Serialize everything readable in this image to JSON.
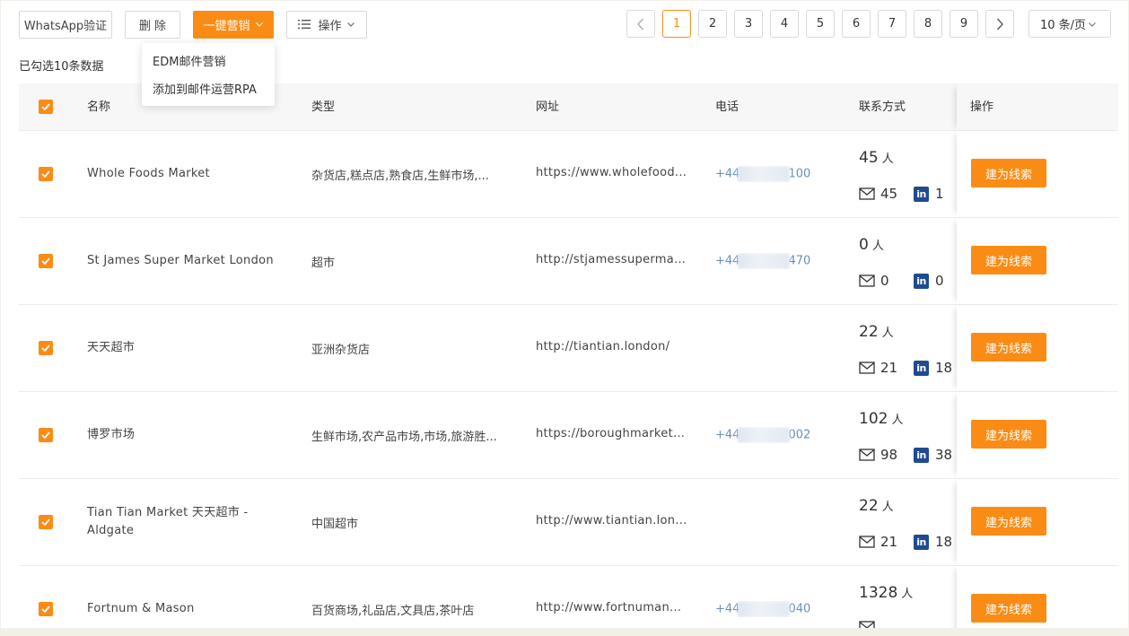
{
  "toolbar": {
    "whatsapp_label": "WhatsApp验证",
    "delete_label": "删 除",
    "marketing_label": "一键营销",
    "ops_label": "操作"
  },
  "dropdown": {
    "items": [
      "EDM邮件营销",
      "添加到邮件运营RPA"
    ]
  },
  "selected_info": "已勾选10条数据",
  "pagination": {
    "pages": [
      "1",
      "2",
      "3",
      "4",
      "5",
      "6",
      "7",
      "8",
      "9"
    ],
    "current": "1",
    "page_size": "10 条/页"
  },
  "table": {
    "headers": {
      "name": "名称",
      "type": "类型",
      "url": "网址",
      "phone": "电话",
      "contact": "联系方式",
      "action": "操作"
    },
    "unit_people": "人",
    "action_button": "建为线索",
    "rows": [
      {
        "name": "Whole Foods Market",
        "type": "杂货店,糕点店,熟食店,生鲜市场,...",
        "url": "https://www.wholefood...",
        "phone_prefix": "+44",
        "phone_suffix": "100",
        "people": "45",
        "email": "45",
        "linkedin": "1"
      },
      {
        "name": "St James Super Market London",
        "type": "超市",
        "url": "http://stjamessupermar...",
        "phone_prefix": "+44",
        "phone_suffix": "470",
        "people": "0",
        "email": "0",
        "linkedin": "0"
      },
      {
        "name": "天天超市",
        "type": "亚洲杂货店",
        "url": "http://tiantian.london/",
        "phone_prefix": "",
        "phone_suffix": "",
        "people": "22",
        "email": "21",
        "linkedin": "18"
      },
      {
        "name": "博罗市场",
        "type": "生鲜市场,农产品市场,市场,旅游胜...",
        "url": "https://boroughmarket....",
        "phone_prefix": "+44",
        "phone_suffix": "002",
        "people": "102",
        "email": "98",
        "linkedin": "38"
      },
      {
        "name": "Tian Tian Market 天天超市 - Aldgate",
        "type": "中国超市",
        "url": "http://www.tiantian.lon...",
        "phone_prefix": "",
        "phone_suffix": "",
        "people": "22",
        "email": "21",
        "linkedin": "18"
      },
      {
        "name": "Fortnum & Mason",
        "type": "百货商场,礼品店,文具店,茶叶店",
        "url": "http://www.fortnumand...",
        "phone_prefix": "+44",
        "phone_suffix": "040",
        "people": "1328",
        "email": "",
        "linkedin": ""
      }
    ]
  },
  "colors": {
    "accent": "#fa8c16",
    "linkedin": "#1f4b8f",
    "phone": "#6a8fb8"
  }
}
